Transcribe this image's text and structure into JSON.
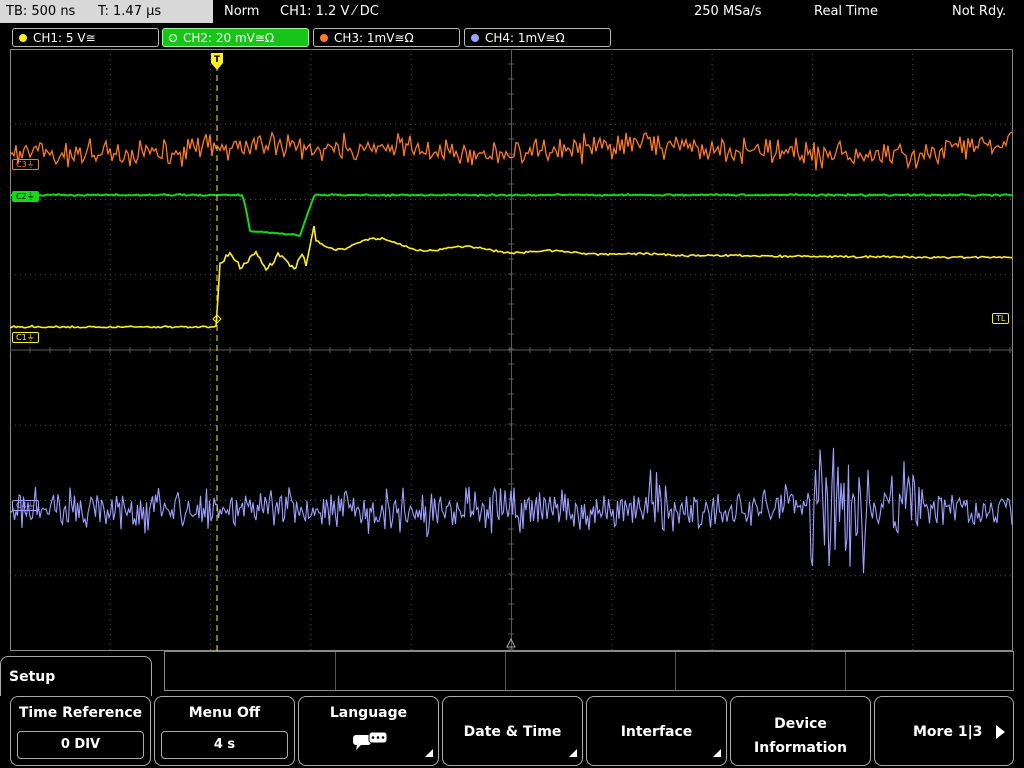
{
  "status_bar": {
    "timebase": "TB: 500 ns",
    "trigger_time": "T: 1.47 µs",
    "trigger_mode": "Norm",
    "trigger_info": "CH1: 1.2 V ⁄ DC",
    "sample_rate": "250 MSa/s",
    "acq_mode": "Real Time",
    "acq_status": "Not Rdy."
  },
  "channels": [
    {
      "label": "CH1: 5 V≅",
      "color": "#ffef1a",
      "active": false
    },
    {
      "label": "CH2: 20 mV≅Ω",
      "color": "#16d816",
      "active": true
    },
    {
      "label": "CH3: 1mV≅Ω",
      "color": "#ff7b1f",
      "active": false
    },
    {
      "label": "CH4: 1mV≅Ω",
      "color": "#9f9fff",
      "active": false
    }
  ],
  "markers": {
    "c1": "C1",
    "c2": "C2",
    "c3": "C3",
    "c4": "C4",
    "trigger_level": "TL",
    "trigger_pos": "T"
  },
  "menu": {
    "title": "Setup",
    "softkeys": [
      {
        "label": "Time Reference",
        "value": "0 DIV",
        "submenu": false
      },
      {
        "label": "Menu Off",
        "value": "4 s",
        "submenu": false
      },
      {
        "label": "Language",
        "value": "",
        "submenu": true,
        "icon": "speech-bubbles-icon"
      },
      {
        "label": "Date & Time",
        "value": "",
        "submenu": true
      },
      {
        "label": "Interface",
        "value": "",
        "submenu": true
      },
      {
        "label": "Device\nInformation",
        "value": "",
        "submenu": false
      },
      {
        "label": "More 1|3",
        "value": "",
        "submenu": false,
        "icon": "arrow-right-icon"
      }
    ]
  },
  "colors": {
    "ch1": "#ffef1a",
    "ch2": "#16d816",
    "ch3": "#ff7b1f",
    "ch4": "#9f9fff",
    "grid": "#5a5a5a"
  }
}
